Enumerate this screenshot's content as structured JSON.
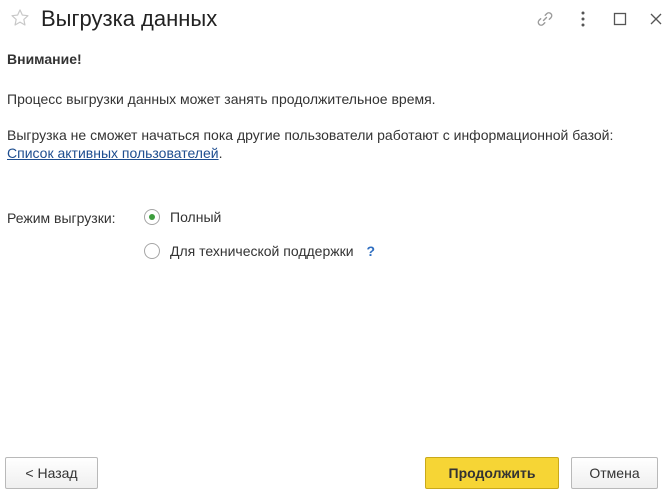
{
  "window": {
    "title": "Выгрузка данных",
    "star_icon": "star-outline-icon",
    "controls": [
      "link-icon",
      "more-vertical-icon",
      "maximize-icon",
      "close-icon"
    ]
  },
  "content": {
    "warning_title": "Внимание!",
    "paragraph1": "Процесс выгрузки данных может занять продолжительное время.",
    "paragraph2_text": "Выгрузка не сможет начаться пока другие пользователи работают с информационной базой: ",
    "paragraph2_link": "Список активных пользователей",
    "paragraph2_end": "."
  },
  "mode": {
    "label": "Режим выгрузки:",
    "options": [
      {
        "label": "Полный",
        "selected": true
      },
      {
        "label": "Для технической поддержки",
        "selected": false
      }
    ],
    "help": "?"
  },
  "footer": {
    "back_label": "< Назад",
    "continue_label": "Продолжить",
    "cancel_label": "Отмена"
  },
  "colors": {
    "primary_button": "#f6d535",
    "radio_dot": "#3d9d3d",
    "link": "#1d4d8f",
    "help": "#2f6ec0"
  }
}
